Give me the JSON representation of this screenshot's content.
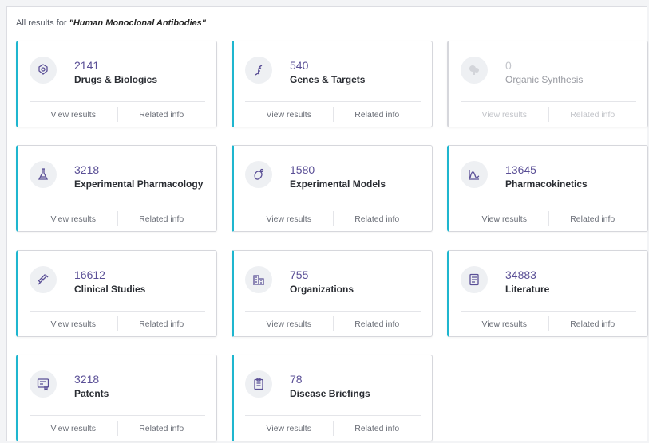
{
  "heading": {
    "prefix": "All results for ",
    "query": "\"Human Monoclonal Antibodies\""
  },
  "actions": {
    "view": "View results",
    "related": "Related info"
  },
  "colors": {
    "accent": "#1eb6cf",
    "count": "#5a4f96",
    "disabled": "#c4c6cc"
  },
  "cards": [
    {
      "count": "2141",
      "label": "Drugs & Biologics",
      "icon": "pill-icon",
      "enabled": true
    },
    {
      "count": "540",
      "label": "Genes & Targets",
      "icon": "dna-icon",
      "enabled": true
    },
    {
      "count": "0",
      "label": "Organic Synthesis",
      "icon": "molecule-icon",
      "enabled": false
    },
    {
      "count": "3218",
      "label": "Experimental Pharmacology",
      "icon": "flask-icon",
      "enabled": true
    },
    {
      "count": "1580",
      "label": "Experimental Models",
      "icon": "cell-icon",
      "enabled": true
    },
    {
      "count": "13645",
      "label": "Pharmacokinetics",
      "icon": "chart-icon",
      "enabled": true
    },
    {
      "count": "16612",
      "label": "Clinical Studies",
      "icon": "syringe-icon",
      "enabled": true
    },
    {
      "count": "755",
      "label": "Organizations",
      "icon": "building-icon",
      "enabled": true
    },
    {
      "count": "34883",
      "label": "Literature",
      "icon": "document-icon",
      "enabled": true
    },
    {
      "count": "3218",
      "label": "Patents",
      "icon": "certificate-icon",
      "enabled": true
    },
    {
      "count": "78",
      "label": "Disease Briefings",
      "icon": "clipboard-icon",
      "enabled": true
    }
  ]
}
